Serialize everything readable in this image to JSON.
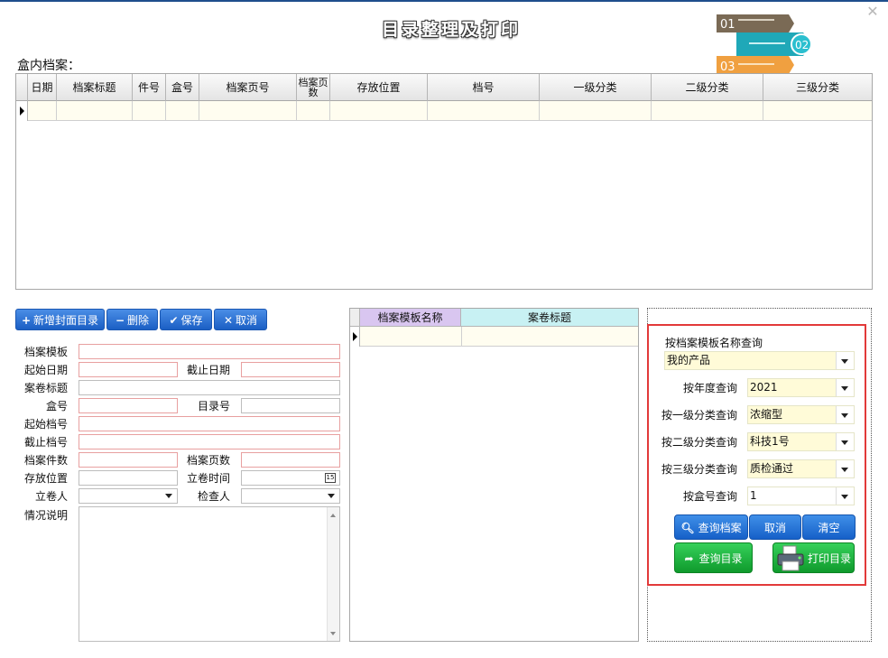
{
  "window": {
    "title": "目录整理及打印",
    "close_glyph": "✕"
  },
  "logo": {
    "step1": "01",
    "step2": "02",
    "step3": "03"
  },
  "top_grid": {
    "section_label": "盒内档案：",
    "columns": [
      "日期",
      "档案标题",
      "件号",
      "盒号",
      "档案页号",
      "档案页数",
      "存放位置",
      "档号",
      "一级分类",
      "二级分类",
      "三级分类"
    ]
  },
  "toolbar": {
    "add_label": "新增封面目录",
    "delete_label": "删除",
    "save_label": "保存",
    "cancel_label": "取消"
  },
  "form": {
    "template_label": "档案模板",
    "start_date_label": "起始日期",
    "end_date_label": "截止日期",
    "volume_title_label": "案卷标题",
    "box_no_label": "盒号",
    "catalog_no_label": "目录号",
    "start_file_no_label": "起始档号",
    "end_file_no_label": "截止档号",
    "file_count_label": "档案件数",
    "page_count_label": "档案页数",
    "storage_label": "存放位置",
    "filing_time_label": "立卷时间",
    "filer_label": "立卷人",
    "checker_label": "检查人",
    "notes_label": "情况说明",
    "calendar_glyph": "15"
  },
  "mid_grid": {
    "col1": "档案模板名称",
    "col2": "案卷标题"
  },
  "query": {
    "template_label": "按档案模板名称查询",
    "template_value": "我的产品",
    "year_label": "按年度查询",
    "year_value": "2021",
    "cat1_label": "按一级分类查询",
    "cat1_value": "浓缩型",
    "cat2_label": "按二级分类查询",
    "cat2_value": "科技1号",
    "cat3_label": "按三级分类查询",
    "cat3_value": "质检通过",
    "box_label": "按盒号查询",
    "box_value": "1",
    "query_files_label": "查询档案",
    "cancel_label": "取消",
    "clear_label": "清空",
    "query_catalog_label": "查询目录",
    "print_catalog_label": "打印目录"
  }
}
